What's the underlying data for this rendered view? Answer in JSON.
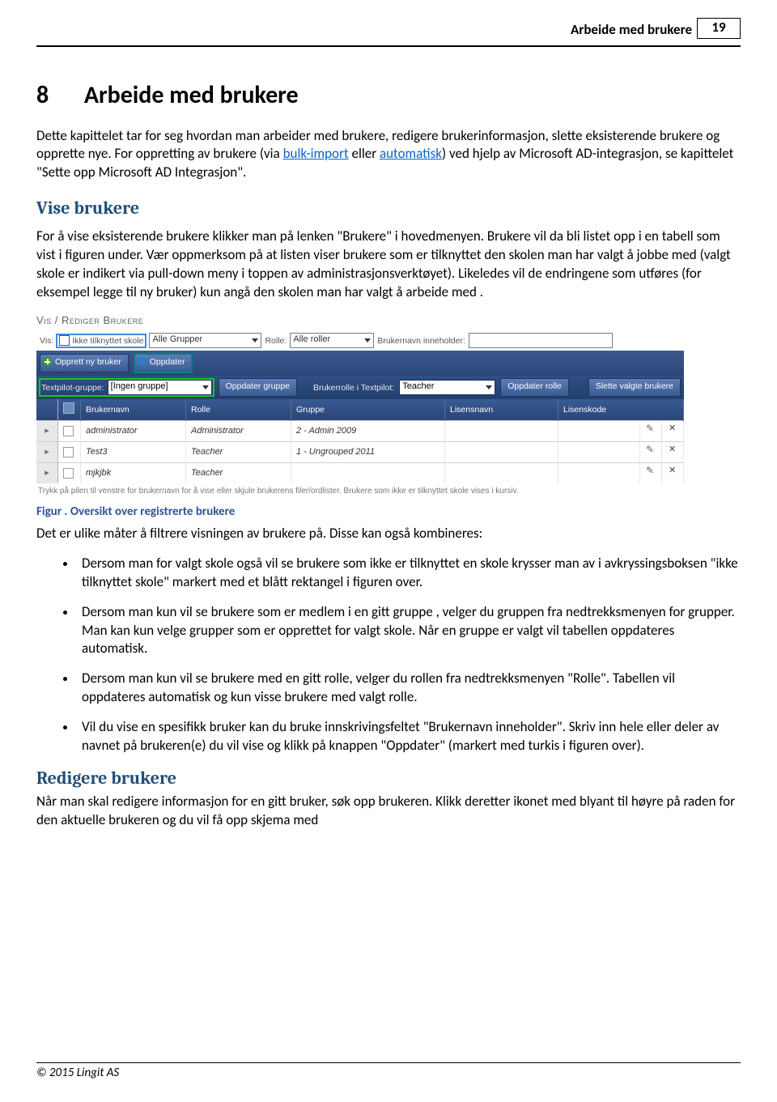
{
  "header": {
    "section_title": "Arbeide med brukere",
    "page_number": "19"
  },
  "chapter": {
    "number": "8",
    "title": "Arbeide med brukere"
  },
  "intro": {
    "p1a": "Dette kapittelet tar for seg hvordan man arbeider med brukere, redigere brukerinformasjon, slette eksisterende  brukere og opprette nye. For oppretting av brukere (via ",
    "link1": "bulk-import",
    "p1b": " eller ",
    "link2": "automatisk",
    "p1c": ") ved hjelp av Microsoft AD-integrasjon, se kapittelet \"Sette opp Microsoft AD Integrasjon\"."
  },
  "sections": {
    "vise_title": "Vise brukere",
    "vise_body": "For å vise eksisterende brukere klikker man på lenken \"Brukere\"  i hovedmenyen. Brukere vil da bli listet opp i en tabell som vist i figuren under. Vær oppmerksom på at listen viser brukere som er tilknyttet den skolen man har valgt å jobbe med (valgt skole er indikert via pull-down meny i toppen av administrasjonsverktøyet). Likeledes vil de endringene som utføres (for eksempel legge til ny bruker) kun angå den skolen man har valgt å arbeide med .",
    "fig_caption": "Figur . Oversikt over registrerte brukere",
    "filter_intro": "Det er ulike måter å filtrere visningen av brukere på. Disse kan også kombineres:",
    "bullets": [
      "Dersom man for valgt skole også vil se brukere som ikke er tilknyttet en skole krysser man av i avkryssingsboksen \"ikke tilknyttet skole\" markert med et blått rektangel i figuren over.",
      "Dersom man kun vil se brukere som er medlem i en gitt gruppe , velger du gruppen fra nedtrekksmenyen for grupper.  Man kan kun velge grupper som er opprettet for valgt skole. Når en gruppe er valgt vil tabellen oppdateres automatisk.",
      "Dersom man kun vil se brukere med en gitt rolle, velger du rollen fra nedtrekksmenyen \"Rolle\". Tabellen vil oppdateres automatisk og kun visse brukere med valgt rolle.",
      "Vil du vise en spesifikk bruker kan du bruke innskrivingsfeltet  \"Brukernavn inneholder\". Skriv inn hele eller deler av navnet på brukeren(e) du vil vise og klikk på knappen \"Oppdater\" (markert med turkis i figuren over)."
    ],
    "redigere_title": "Redigere brukere",
    "redigere_body": "Når man skal redigere informasjon for en gitt bruker, søk opp brukeren. Klikk deretter ikonet med blyant til høyre på raden for den aktuelle brukeren og du vil få opp skjema med"
  },
  "ui": {
    "title_caps": "Vis / Rediger Brukere",
    "vis_label": "Vis:",
    "chk_label": "Ikke tilknyttet skole",
    "group_value": "Alle Grupper",
    "rolle_label": "Rolle:",
    "rolle_value": "Alle roller",
    "search_label": "Brukernavn inneholder:",
    "btn_new": "Opprett ny bruker",
    "btn_refresh": "Oppdater",
    "tp_group_label": "Textpilot-gruppe:",
    "tp_group_value": "[Ingen gruppe]",
    "btn_upd_group": "Oppdater gruppe",
    "tp_role_label": "Brukerrolle i Textpilot:",
    "tp_role_value": "Teacher",
    "btn_upd_role": "Oppdater rolle",
    "btn_delete": "Slette valgte brukere",
    "columns": {
      "user": "Brukernavn",
      "role": "Rolle",
      "group": "Gruppe",
      "licname": "Lisensnavn",
      "liccode": "Lisenskode"
    },
    "rows": [
      {
        "user": "administrator",
        "role": "Administrator",
        "group": "2 - Admin 2009"
      },
      {
        "user": "Test3",
        "role": "Teacher",
        "group": "1 - Ungrouped 2011"
      },
      {
        "user": "mjkjbk",
        "role": "Teacher",
        "group": ""
      }
    ],
    "hint": "Trykk på pilen til venstre for brukernavn for å vise eller skjule brukerens filer/ordlister. Brukere som ikke er tilknyttet skole vises i kursiv."
  },
  "footer": {
    "copyright": "© 2015 Lingit AS"
  }
}
